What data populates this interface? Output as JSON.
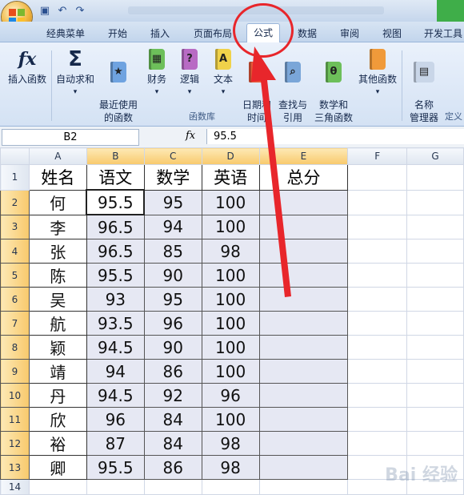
{
  "title_bar": {
    "qat": [
      "💾",
      "↶",
      "↷"
    ]
  },
  "tabs": [
    "经典菜单",
    "开始",
    "插入",
    "页面布局",
    "公式",
    "数据",
    "审阅",
    "视图",
    "开发工具"
  ],
  "active_tab": "公式",
  "ribbon": {
    "buttons": [
      {
        "label": "插入函数"
      },
      {
        "label": "自动求和"
      },
      {
        "label": "最近使用\n的函数"
      },
      {
        "label": "财务"
      },
      {
        "label": "逻辑"
      },
      {
        "label": "文本"
      },
      {
        "label": "日期和\n时间"
      },
      {
        "label": "查找与\n引用"
      },
      {
        "label": "数学和\n三角函数"
      },
      {
        "label": "其他函数"
      },
      {
        "label": "名称\n管理器"
      }
    ],
    "group_label": "函数库",
    "group_label2": "定义"
  },
  "formula_bar": {
    "name_box": "B2",
    "fx": "fx",
    "value": "95.5"
  },
  "columns": [
    "A",
    "B",
    "C",
    "D",
    "E",
    "F",
    "G"
  ],
  "rows": [
    "1",
    "2",
    "3",
    "4",
    "5",
    "6",
    "7",
    "8",
    "9",
    "10",
    "11",
    "12",
    "13",
    "14"
  ],
  "table": {
    "header": [
      "姓名",
      "语文",
      "数学",
      "英语",
      "总分"
    ],
    "data": [
      [
        "何",
        "95.5",
        "95",
        "100",
        ""
      ],
      [
        "李",
        "96.5",
        "94",
        "100",
        ""
      ],
      [
        "张",
        "96.5",
        "85",
        "98",
        ""
      ],
      [
        "陈",
        "95.5",
        "90",
        "100",
        ""
      ],
      [
        "吴",
        "93",
        "95",
        "100",
        ""
      ],
      [
        "航",
        "93.5",
        "96",
        "100",
        ""
      ],
      [
        "颖",
        "94.5",
        "90",
        "100",
        ""
      ],
      [
        "靖",
        "94",
        "86",
        "100",
        ""
      ],
      [
        "丹",
        "94.5",
        "92",
        "96",
        ""
      ],
      [
        "欣",
        "96",
        "84",
        "100",
        ""
      ],
      [
        "裕",
        "87",
        "84",
        "98",
        ""
      ],
      [
        "卿",
        "95.5",
        "86",
        "98",
        ""
      ]
    ]
  },
  "watermark": "Bai 经验"
}
